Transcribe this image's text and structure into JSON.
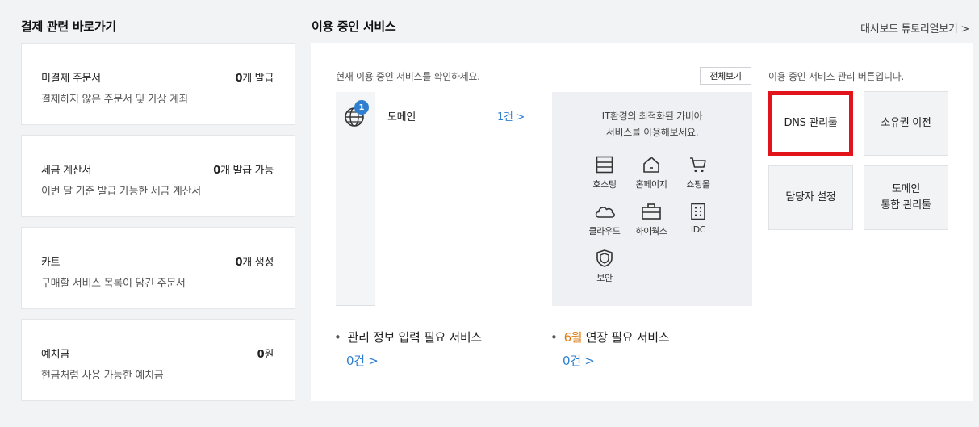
{
  "left_section": {
    "title": "결제 관련 바로가기",
    "cards": [
      {
        "title": "미결제 주문서",
        "count": "0",
        "unit": "개 발급",
        "desc": "결제하지 않은 주문서 및 가상 계좌"
      },
      {
        "title": "세금 계산서",
        "count": "0",
        "unit": "개 발급 가능",
        "desc": "이번 달 기준 발급 가능한 세금 계산서"
      },
      {
        "title": "카트",
        "count": "0",
        "unit": "개 생성",
        "desc": "구매할 서비스 목록이 담긴 주문서"
      },
      {
        "title": "예치금",
        "count": "0",
        "unit": "원",
        "desc": "현금처럼 사용 가능한 예치금"
      }
    ]
  },
  "right_section": {
    "title": "이용 중인 서비스",
    "dashboard_link": "대시보드 튜토리얼보기 >",
    "hint_left": "현재 이용 중인 서비스를 확인하세요.",
    "view_all": "전체보기",
    "hint_right": "이용 중인 서비스 관리 버튼입니다.",
    "service": {
      "badge": "1",
      "name": "도메인",
      "count": "1건 >",
      "icon": "globe-icon"
    },
    "promo": {
      "line1": "IT환경의 최적화된 가비아",
      "line2": "서비스를 이용해보세요.",
      "items": [
        {
          "label": "호스팅",
          "icon": "hosting-icon"
        },
        {
          "label": "홈페이지",
          "icon": "homepage-icon"
        },
        {
          "label": "쇼핑몰",
          "icon": "shopping-cart-icon"
        },
        {
          "label": "클라우드",
          "icon": "cloud-icon"
        },
        {
          "label": "하이웍스",
          "icon": "briefcase-icon"
        },
        {
          "label": "IDC",
          "icon": "idc-server-icon"
        },
        {
          "label": "보안",
          "icon": "shield-icon"
        }
      ]
    },
    "manage_buttons": [
      {
        "label": "DNS 관리툴",
        "highlight_color": "#e3131b"
      },
      {
        "label": "소유권 이전"
      },
      {
        "label": "담당자 설정"
      },
      {
        "label_line1": "도메인",
        "label_line2": "통합 관리툴"
      }
    ],
    "bottom": {
      "info_title": "관리 정보 입력 필요 서비스",
      "info_count": "0건 >",
      "renew_month": "6월",
      "renew_title": " 연장 필요 서비스",
      "renew_count": "0건 >"
    }
  },
  "colors": {
    "accent_blue": "#2f7fd0",
    "highlight_red": "#e3131b",
    "month_orange": "#e07b10"
  }
}
